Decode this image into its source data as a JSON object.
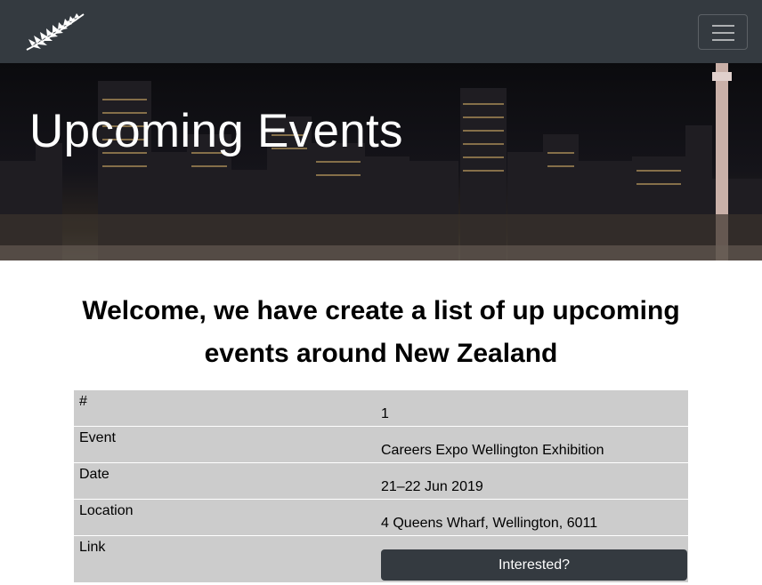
{
  "navbar": {
    "logo_icon": "silver-fern-icon",
    "toggler_icon": "hamburger-menu-icon",
    "background": "#343a40"
  },
  "hero": {
    "title": "Upcoming Events"
  },
  "welcome": {
    "heading": "Welcome, we have create a list of up upcoming events around New Zealand"
  },
  "event": {
    "rows": [
      {
        "label": "#",
        "value": "1"
      },
      {
        "label": "Event",
        "value": "Careers Expo Wellington Exhibition"
      },
      {
        "label": "Date",
        "value": "21–22 Jun 2019"
      },
      {
        "label": "Location",
        "value": "4 Queens Wharf, Wellington, 6011"
      }
    ],
    "link_label": "Link",
    "button_label": "Interested?"
  },
  "colors": {
    "table_background": "#cccccc",
    "button_background": "#343a40"
  }
}
